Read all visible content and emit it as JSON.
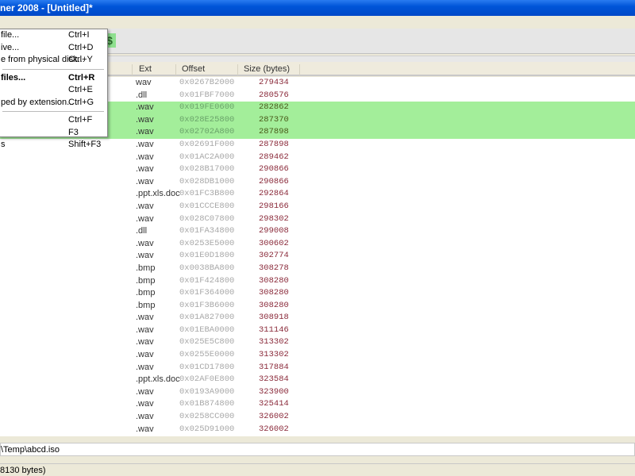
{
  "window": {
    "title": "ner 2008 - [Untitled]*"
  },
  "toolbar": {
    "icon": "dollar-icon"
  },
  "menu": {
    "groups": [
      [
        {
          "label": "file...",
          "shortcut": "Ctrl+I"
        },
        {
          "label": "ive...",
          "shortcut": "Ctrl+D"
        },
        {
          "label": "e from physical disk...",
          "shortcut": "Ctrl+Y"
        }
      ],
      [
        {
          "label": "files...",
          "shortcut": "Ctrl+R",
          "bold": true
        },
        {
          "label": "",
          "shortcut": "Ctrl+E"
        },
        {
          "label": "ped by extension...",
          "shortcut": "Ctrl+G"
        }
      ],
      [
        {
          "label": "",
          "shortcut": "Ctrl+F"
        },
        {
          "label": "",
          "shortcut": "F3"
        },
        {
          "label": "s",
          "shortcut": "Shift+F3"
        }
      ]
    ]
  },
  "table": {
    "columns": [
      "Ext",
      "Offset",
      "Size (bytes)"
    ],
    "rows": [
      [
        "wav",
        "0x0267B2000",
        "279434",
        false
      ],
      [
        ".dll",
        "0x01FBF7000",
        "280576",
        false
      ],
      [
        ".wav",
        "0x019FE0600",
        "282862",
        true
      ],
      [
        ".wav",
        "0x028E25800",
        "287370",
        true
      ],
      [
        ".wav",
        "0x02702A800",
        "287898",
        true
      ],
      [
        ".wav",
        "0x02691F000",
        "287898",
        false
      ],
      [
        ".wav",
        "0x01AC2A000",
        "289462",
        false
      ],
      [
        ".wav",
        "0x028B17000",
        "290866",
        false
      ],
      [
        ".wav",
        "0x028DB1000",
        "290866",
        false
      ],
      [
        ".ppt.xls.doc",
        "0x01FC3B800",
        "292864",
        false
      ],
      [
        ".wav",
        "0x01CCCE800",
        "298166",
        false
      ],
      [
        ".wav",
        "0x028C07800",
        "298302",
        false
      ],
      [
        ".dll",
        "0x01FA34800",
        "299008",
        false
      ],
      [
        ".wav",
        "0x0253E5000",
        "300602",
        false
      ],
      [
        ".wav",
        "0x01E0D1800",
        "302774",
        false
      ],
      [
        ".bmp",
        "0x0038BA800",
        "308278",
        false
      ],
      [
        ".bmp",
        "0x01F424800",
        "308280",
        false
      ],
      [
        ".bmp",
        "0x01F364000",
        "308280",
        false
      ],
      [
        ".bmp",
        "0x01F3B6000",
        "308280",
        false
      ],
      [
        ".wav",
        "0x01A827000",
        "308918",
        false
      ],
      [
        ".wav",
        "0x01EBA0000",
        "311146",
        false
      ],
      [
        ".wav",
        "0x025E5C800",
        "313302",
        false
      ],
      [
        ".wav",
        "0x0255E0000",
        "313302",
        false
      ],
      [
        ".wav",
        "0x01CD17800",
        "317884",
        false
      ],
      [
        ".ppt.xls.doc",
        "0x02AF0E800",
        "323584",
        false
      ],
      [
        ".wav",
        "0x0193A9000",
        "323900",
        false
      ],
      [
        ".wav",
        "0x01B874800",
        "325414",
        false
      ],
      [
        ".wav",
        "0x0258CC000",
        "326002",
        false
      ],
      [
        ".wav",
        "0x025D91000",
        "326002",
        false
      ]
    ]
  },
  "path": {
    "value": "\\Temp\\abcd.iso"
  },
  "status": {
    "text": "8130 bytes)"
  },
  "colors": {
    "titlebar": "#0055d8",
    "selected_row": "#a3ee9a",
    "size_text": "#8a2a3a"
  }
}
